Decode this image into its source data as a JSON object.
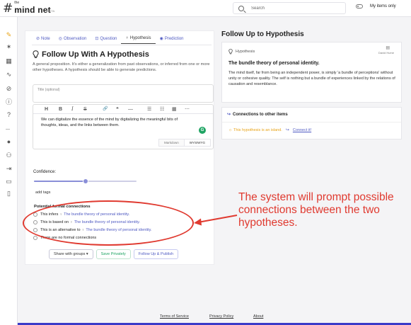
{
  "app": {
    "logo_the": "the",
    "logo_name": "mind net",
    "logo_beta": "BETA"
  },
  "search": {
    "placeholder": "Search"
  },
  "my_items_label": "My items only",
  "sidebar": {
    "items": [
      {
        "name": "sidebar-item-ideas",
        "icon": "✎"
      },
      {
        "name": "sidebar-item-connections",
        "icon": "✶"
      },
      {
        "name": "sidebar-item-board",
        "icon": "▦"
      },
      {
        "name": "sidebar-item-activity",
        "icon": "∿"
      },
      {
        "name": "sidebar-item-explore",
        "icon": "⊘"
      },
      {
        "name": "sidebar-item-info",
        "icon": "ⓘ"
      },
      {
        "name": "sidebar-item-help",
        "icon": "?"
      },
      {
        "name": "sidebar-item-profile",
        "icon": "●"
      },
      {
        "name": "sidebar-item-groups",
        "icon": "⚇"
      },
      {
        "name": "sidebar-item-import",
        "icon": "⇥"
      },
      {
        "name": "sidebar-item-archive",
        "icon": "▭"
      },
      {
        "name": "sidebar-item-notebook",
        "icon": "▯"
      }
    ]
  },
  "tabs": [
    {
      "label": "Note",
      "icon": "⊘"
    },
    {
      "label": "Observation",
      "icon": "◎"
    },
    {
      "label": "Question",
      "icon": "⊡"
    },
    {
      "label": "Hypothesis",
      "icon": "♀"
    },
    {
      "label": "Prediction",
      "icon": "◉"
    }
  ],
  "form": {
    "title": "Follow Up With A Hypothesis",
    "description": "A general proposition. It's either a generalization from past observations, or inferred from one or more other hypotheses. A hypothesis should be able to generate predictions.",
    "title_placeholder": "Title (optional)",
    "body": "We can digitalize the essence of the mind by digitalizing the meaningful bits of thoughts, ideas, and the links between them.",
    "grammar_badge": "G",
    "modes": [
      "Markdown",
      "WYSIWYG"
    ],
    "confidence_label": "Confidence:",
    "confidence": 0.5,
    "tags_label": "add tags",
    "pfc_title": "Potential formal connections",
    "connections": [
      {
        "prefix": "This infers",
        "target": "The bundle theory of personal identity."
      },
      {
        "prefix": "This is based on",
        "target": "The bundle theory of personal identity."
      },
      {
        "prefix": "This is an alternative to",
        "target": "The bundle theory of personal identity."
      },
      {
        "prefix": "There are no formal connections",
        "target": ""
      }
    ],
    "buttons": {
      "share": "Share with groups ▾",
      "save": "Save Privately",
      "publish": "Follow Up & Publish"
    }
  },
  "toolbar": [
    "H",
    "B",
    "I",
    "S",
    "🔗",
    "❝",
    "—",
    "☰",
    "☷",
    "▦",
    "⋯"
  ],
  "right": {
    "title": "Follow Up to Hypothesis",
    "card_type": "Hypothesis",
    "author": "David Hume",
    "card_title": "The bundle theory of personal identity.",
    "card_body": "The mind itself, far from being an independent power, is simply 'a bundle of perceptions' without unity or cohesive quality. The self is nothing but a bundle of experiences linked by the relations of causation and resemblance.",
    "connections_title": "Connections to other items",
    "island_text": "This hypothesis is an island.",
    "connect_link": "Connect it!"
  },
  "annotation": "The system will prompt possible connections between the two hypotheses.",
  "footer": {
    "terms": "Terms of Service",
    "privacy": "Privacy Policy",
    "about": "About"
  },
  "colors": {
    "accent": "#4f5ac2",
    "annotation": "#e03a30",
    "save": "#1fa463",
    "island": "#e8a317"
  }
}
